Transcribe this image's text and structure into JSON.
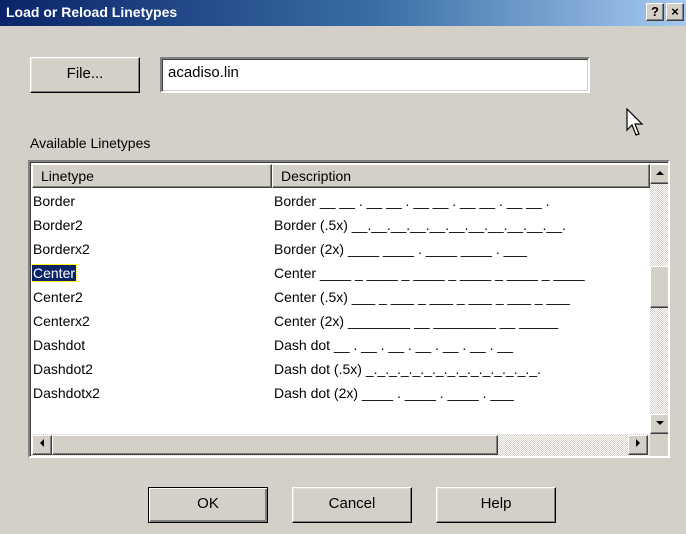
{
  "window": {
    "title": "Load or Reload Linetypes",
    "help_button": "?",
    "close_button": "×"
  },
  "file": {
    "button_label": "File...",
    "value": "acadiso.lin"
  },
  "available": {
    "label": "Available Linetypes",
    "columns": [
      "Linetype",
      "Description"
    ],
    "rows": [
      {
        "name": "Border",
        "desc": "Border __ __ . __ __ . __ __ . __ __ . __ __ ."
      },
      {
        "name": "Border2",
        "desc": "Border (.5x) __.__.__.__.__.__.__.__.__.__.__."
      },
      {
        "name": "Borderx2",
        "desc": "Border (2x) ____ ____ . ____ ____ . ___"
      },
      {
        "name": "Center",
        "desc": "Center ____ _ ____ _ ____ _ ____ _ ____ _ ____",
        "selected": true
      },
      {
        "name": "Center2",
        "desc": "Center (.5x) ___ _ ___ _ ___ _ ___ _ ___ _ ___"
      },
      {
        "name": "Centerx2",
        "desc": "Center (2x) ________ __ ________ __ _____"
      },
      {
        "name": "Dashdot",
        "desc": "Dash dot __ . __ . __ . __ . __ . __ . __"
      },
      {
        "name": "Dashdot2",
        "desc": "Dash dot (.5x) _._._._._._._._._._._._._._._."
      },
      {
        "name": "Dashdotx2",
        "desc": "Dash dot (2x) ____ . ____ . ____ . ___"
      }
    ]
  },
  "buttons": {
    "ok": "OK",
    "cancel": "Cancel",
    "help": "Help"
  }
}
